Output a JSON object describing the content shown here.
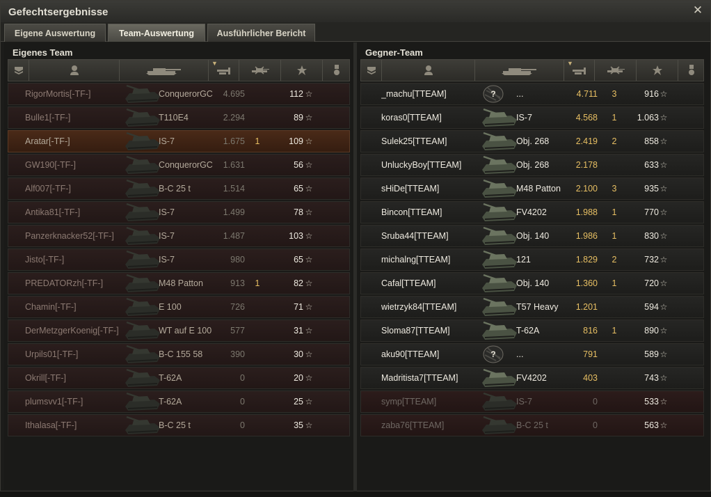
{
  "window": {
    "title": "Gefechtsergebnisse",
    "close_icon": "close-icon"
  },
  "tabs": [
    {
      "label": "Eigene Auswertung",
      "active": false
    },
    {
      "label": "Team-Auswertung",
      "active": true
    },
    {
      "label": "Ausführlicher Bericht",
      "active": false
    }
  ],
  "left_team": {
    "title": "Eigenes Team",
    "players": [
      {
        "name": "RigorMortis[-TF-]",
        "tank": "ConquerorGC",
        "damage": "4.695",
        "kills": "",
        "xp": "112",
        "state": "dead"
      },
      {
        "name": "Bulle1[-TF-]",
        "tank": "T110E4",
        "damage": "2.294",
        "kills": "",
        "xp": "89",
        "state": "dead"
      },
      {
        "name": "Aratar[-TF-]",
        "tank": "IS-7",
        "damage": "1.675",
        "kills": "1",
        "xp": "109",
        "state": "self"
      },
      {
        "name": "GW190[-TF-]",
        "tank": "ConquerorGC",
        "damage": "1.631",
        "kills": "",
        "xp": "56",
        "state": "dead"
      },
      {
        "name": "Alf007[-TF-]",
        "tank": "B-C 25 t",
        "damage": "1.514",
        "kills": "",
        "xp": "65",
        "state": "dead"
      },
      {
        "name": "Antika81[-TF-]",
        "tank": "IS-7",
        "damage": "1.499",
        "kills": "",
        "xp": "78",
        "state": "dead"
      },
      {
        "name": "Panzerknacker52[-TF-]",
        "tank": "IS-7",
        "damage": "1.487",
        "kills": "",
        "xp": "103",
        "state": "dead"
      },
      {
        "name": "Jisto[-TF-]",
        "tank": "IS-7",
        "damage": "980",
        "kills": "",
        "xp": "65",
        "state": "dead"
      },
      {
        "name": "PREDATORzh[-TF-]",
        "tank": "M48 Patton",
        "damage": "913",
        "kills": "1",
        "xp": "82",
        "state": "dead"
      },
      {
        "name": "Chamin[-TF-]",
        "tank": "E 100",
        "damage": "726",
        "kills": "",
        "xp": "71",
        "state": "dead"
      },
      {
        "name": "DerMetzgerKoenig[-TF-]",
        "tank": "WT auf E 100",
        "damage": "577",
        "kills": "",
        "xp": "31",
        "state": "dead"
      },
      {
        "name": "Urpils01[-TF-]",
        "tank": "B-C 155 58",
        "damage": "390",
        "kills": "",
        "xp": "30",
        "state": "dead"
      },
      {
        "name": "Okrill[-TF-]",
        "tank": "T-62A",
        "damage": "0",
        "kills": "",
        "xp": "20",
        "state": "dead"
      },
      {
        "name": "plumsvv1[-TF-]",
        "tank": "T-62A",
        "damage": "0",
        "kills": "",
        "xp": "25",
        "state": "dead"
      },
      {
        "name": "Ithalasa[-TF-]",
        "tank": "B-C 25 t",
        "damage": "0",
        "kills": "",
        "xp": "35",
        "state": "dead"
      }
    ]
  },
  "right_team": {
    "title": "Gegner-Team",
    "players": [
      {
        "name": "_machu[TTEAM]",
        "tank": "...",
        "damage": "4.711",
        "kills": "3",
        "xp": "916",
        "state": "alive",
        "unknown": true
      },
      {
        "name": "koras0[TTEAM]",
        "tank": "IS-7",
        "damage": "4.568",
        "kills": "1",
        "xp": "1.063",
        "state": "alive"
      },
      {
        "name": "Sulek25[TTEAM]",
        "tank": "Obj. 268",
        "damage": "2.419",
        "kills": "2",
        "xp": "858",
        "state": "alive"
      },
      {
        "name": "UnluckyBoy[TTEAM]",
        "tank": "Obj. 268",
        "damage": "2.178",
        "kills": "",
        "xp": "633",
        "state": "alive"
      },
      {
        "name": "sHiDe[TTEAM]",
        "tank": "M48 Patton",
        "damage": "2.100",
        "kills": "3",
        "xp": "935",
        "state": "alive"
      },
      {
        "name": "Bincon[TTEAM]",
        "tank": "FV4202",
        "damage": "1.988",
        "kills": "1",
        "xp": "770",
        "state": "alive"
      },
      {
        "name": "Sruba44[TTEAM]",
        "tank": "Obj. 140",
        "damage": "1.986",
        "kills": "1",
        "xp": "830",
        "state": "alive"
      },
      {
        "name": "michalng[TTEAM]",
        "tank": "121",
        "damage": "1.829",
        "kills": "2",
        "xp": "732",
        "state": "alive"
      },
      {
        "name": "Cafal[TTEAM]",
        "tank": "Obj. 140",
        "damage": "1.360",
        "kills": "1",
        "xp": "720",
        "state": "alive"
      },
      {
        "name": "wietrzyk84[TTEAM]",
        "tank": "T57 Heavy",
        "damage": "1.201",
        "kills": "",
        "xp": "594",
        "state": "alive"
      },
      {
        "name": "Sloma87[TTEAM]",
        "tank": "T-62A",
        "damage": "816",
        "kills": "1",
        "xp": "890",
        "state": "alive"
      },
      {
        "name": "aku90[TTEAM]",
        "tank": "...",
        "damage": "791",
        "kills": "",
        "xp": "589",
        "state": "alive",
        "unknown": true
      },
      {
        "name": "Madritista7[TTEAM]",
        "tank": "FV4202",
        "damage": "403",
        "kills": "",
        "xp": "743",
        "state": "alive"
      },
      {
        "name": "symp[TTEAM]",
        "tank": "IS-7",
        "damage": "0",
        "kills": "",
        "xp": "533",
        "state": "dead"
      },
      {
        "name": "zaba76[TTEAM]",
        "tank": "B-C 25 t",
        "damage": "0",
        "kills": "",
        "xp": "563",
        "state": "dead"
      }
    ]
  },
  "columns": [
    {
      "icon": "platoon-icon"
    },
    {
      "icon": "player-icon"
    },
    {
      "icon": "tank-icon"
    },
    {
      "icon": "damage-icon",
      "sorted": true
    },
    {
      "icon": "kills-icon"
    },
    {
      "icon": "xp-star-icon"
    },
    {
      "icon": "medal-icon"
    }
  ],
  "colors": {
    "gold": "#e7bf63",
    "self_row": "#4a2a18",
    "dead_row": "#2c1c1b"
  },
  "row_icons": {
    "xp": "star-icon",
    "unknown_tank": "question-mark-icon"
  }
}
